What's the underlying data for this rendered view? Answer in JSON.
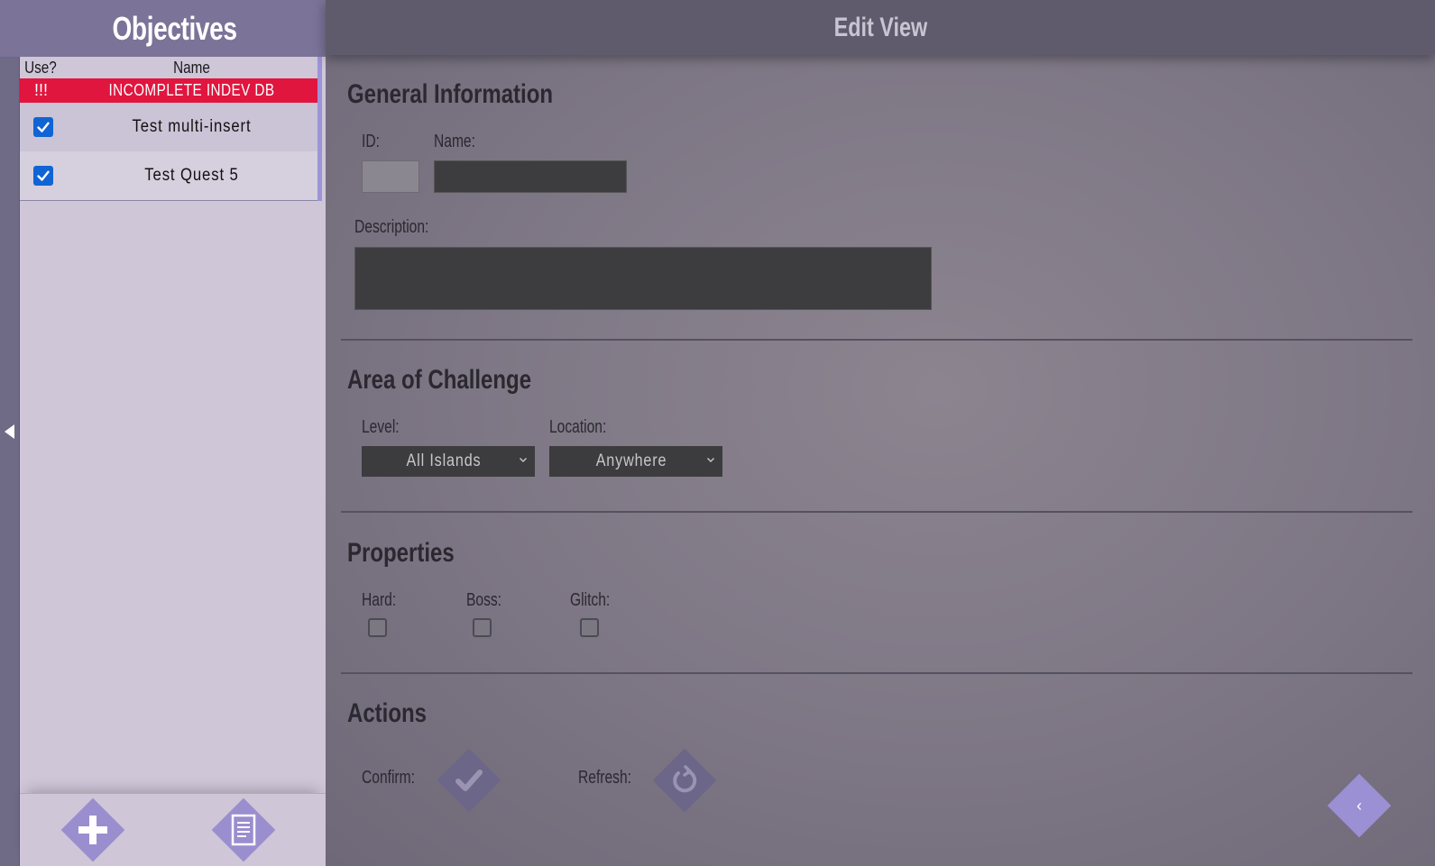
{
  "sidebar": {
    "title": "Objectives",
    "table": {
      "col_use": "Use?",
      "col_name": "Name",
      "alert_row": {
        "marker": "!!!",
        "label": "INCOMPLETE INDEV DB"
      },
      "rows": [
        {
          "name": "Test multi-insert",
          "checked": true
        },
        {
          "name": "Test Quest 5",
          "checked": true
        }
      ]
    },
    "footer": {
      "add_icon": "plus-icon",
      "list_icon": "document-list-icon"
    }
  },
  "main": {
    "title": "Edit View",
    "general": {
      "title": "General Information",
      "id_label": "ID:",
      "id_value": "",
      "name_label": "Name:",
      "name_value": "",
      "description_label": "Description:",
      "description_value": ""
    },
    "area": {
      "title": "Area of Challenge",
      "level_label": "Level:",
      "level_value": "All Islands",
      "location_label": "Location:",
      "location_value": "Anywhere"
    },
    "properties": {
      "title": "Properties",
      "hard_label": "Hard:",
      "boss_label": "Boss:",
      "glitch_label": "Glitch:",
      "hard": false,
      "boss": false,
      "glitch": false
    },
    "actions": {
      "title": "Actions",
      "confirm_label": "Confirm:",
      "refresh_label": "Refresh:"
    },
    "back_label": "‹"
  },
  "colors": {
    "sidebar_header": "#7b7398",
    "alert_row": "#e0163f",
    "checkbox": "#1064d4",
    "diamond_button": "#9a8ecf",
    "main_header": "#5f5b6c"
  }
}
